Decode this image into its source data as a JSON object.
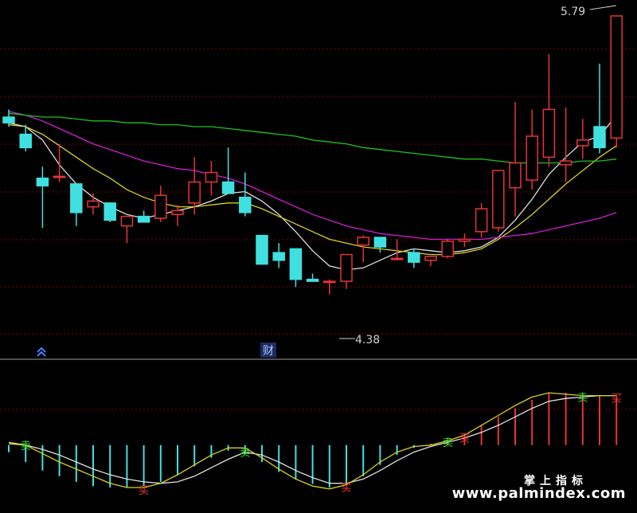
{
  "chart_data": [
    {
      "type": "candlestick",
      "panel": "price",
      "ylim": [
        4.1,
        5.84
      ],
      "high_label": "5.79",
      "low_label": "4.38",
      "event_marker": "财",
      "candles": [
        {
          "o": 5.26,
          "h": 5.3,
          "l": 5.21,
          "c": 5.23
        },
        {
          "o": 5.17,
          "h": 5.22,
          "l": 5.08,
          "c": 5.1
        },
        {
          "o": 4.94,
          "h": 5.0,
          "l": 4.68,
          "c": 4.9
        },
        {
          "o": 4.95,
          "h": 5.12,
          "l": 4.92,
          "c": 4.95
        },
        {
          "o": 4.91,
          "h": 4.91,
          "l": 4.69,
          "c": 4.76
        },
        {
          "o": 4.79,
          "h": 4.86,
          "l": 4.75,
          "c": 4.82
        },
        {
          "o": 4.81,
          "h": 4.81,
          "l": 4.71,
          "c": 4.72
        },
        {
          "o": 4.69,
          "h": 4.74,
          "l": 4.6,
          "c": 4.74
        },
        {
          "o": 4.74,
          "h": 4.77,
          "l": 4.72,
          "c": 4.71
        },
        {
          "o": 4.73,
          "h": 4.9,
          "l": 4.71,
          "c": 4.85
        },
        {
          "o": 4.75,
          "h": 4.8,
          "l": 4.69,
          "c": 4.77
        },
        {
          "o": 4.81,
          "h": 5.05,
          "l": 4.75,
          "c": 4.92
        },
        {
          "o": 4.92,
          "h": 5.03,
          "l": 4.85,
          "c": 4.97
        },
        {
          "o": 4.92,
          "h": 5.1,
          "l": 4.86,
          "c": 4.86
        },
        {
          "o": 4.84,
          "h": 4.97,
          "l": 4.74,
          "c": 4.76
        },
        {
          "o": 4.64,
          "h": 4.64,
          "l": 4.49,
          "c": 4.49
        },
        {
          "o": 4.55,
          "h": 4.6,
          "l": 4.47,
          "c": 4.51
        },
        {
          "o": 4.57,
          "h": 4.57,
          "l": 4.37,
          "c": 4.41
        },
        {
          "o": 4.41,
          "h": 4.44,
          "l": 4.4,
          "c": 4.4
        },
        {
          "o": 4.4,
          "h": 4.41,
          "l": 4.33,
          "c": 4.4
        },
        {
          "o": 4.4,
          "h": 4.54,
          "l": 4.36,
          "c": 4.54
        },
        {
          "o": 4.59,
          "h": 4.64,
          "l": 4.5,
          "c": 4.63
        },
        {
          "o": 4.63,
          "h": 4.63,
          "l": 4.55,
          "c": 4.58
        },
        {
          "o": 4.52,
          "h": 4.62,
          "l": 4.51,
          "c": 4.52
        },
        {
          "o": 4.55,
          "h": 4.57,
          "l": 4.47,
          "c": 4.5
        },
        {
          "o": 4.51,
          "h": 4.53,
          "l": 4.48,
          "c": 4.53
        },
        {
          "o": 4.53,
          "h": 4.62,
          "l": 4.52,
          "c": 4.61
        },
        {
          "o": 4.61,
          "h": 4.65,
          "l": 4.58,
          "c": 4.62
        },
        {
          "o": 4.66,
          "h": 4.81,
          "l": 4.63,
          "c": 4.78
        },
        {
          "o": 4.68,
          "h": 4.98,
          "l": 4.66,
          "c": 4.98
        },
        {
          "o": 4.89,
          "h": 5.34,
          "l": 4.74,
          "c": 5.02
        },
        {
          "o": 4.93,
          "h": 5.3,
          "l": 4.88,
          "c": 5.16
        },
        {
          "o": 5.05,
          "h": 5.59,
          "l": 5.0,
          "c": 5.3
        },
        {
          "o": 5.01,
          "h": 5.31,
          "l": 4.92,
          "c": 5.03
        },
        {
          "o": 5.11,
          "h": 5.25,
          "l": 5.04,
          "c": 5.14
        },
        {
          "o": 5.21,
          "h": 5.54,
          "l": 5.07,
          "c": 5.1
        },
        {
          "o": 5.15,
          "h": 5.79,
          "l": 5.1,
          "c": 5.79
        }
      ],
      "ma_lines": [
        {
          "color": "#e0e0e0",
          "values": [
            5.23,
            5.21,
            5.14,
            5.01,
            4.91,
            4.84,
            4.79,
            4.75,
            4.73,
            4.75,
            4.77,
            4.79,
            4.82,
            4.86,
            4.87,
            4.82,
            4.75,
            4.66,
            4.56,
            4.48,
            4.46,
            4.47,
            4.51,
            4.55,
            4.57,
            4.56,
            4.55,
            4.56,
            4.58,
            4.63,
            4.72,
            4.83,
            4.96,
            5.05,
            5.13,
            5.16,
            5.27
          ]
        },
        {
          "color": "#d8d020",
          "values": [
            5.22,
            5.21,
            5.17,
            5.11,
            5.05,
            4.99,
            4.94,
            4.88,
            4.84,
            4.81,
            4.79,
            4.79,
            4.8,
            4.81,
            4.81,
            4.78,
            4.74,
            4.7,
            4.66,
            4.62,
            4.6,
            4.58,
            4.57,
            4.56,
            4.55,
            4.54,
            4.54,
            4.55,
            4.57,
            4.62,
            4.68,
            4.75,
            4.83,
            4.91,
            4.98,
            5.05,
            5.11
          ]
        },
        {
          "color": "#d020d0",
          "values": [
            5.29,
            5.27,
            5.24,
            5.2,
            5.16,
            5.12,
            5.09,
            5.06,
            5.03,
            5.01,
            4.99,
            4.98,
            4.96,
            4.94,
            4.91,
            4.87,
            4.83,
            4.79,
            4.75,
            4.72,
            4.69,
            4.67,
            4.65,
            4.64,
            4.63,
            4.62,
            4.62,
            4.62,
            4.62,
            4.63,
            4.64,
            4.65,
            4.67,
            4.69,
            4.71,
            4.73,
            4.76
          ]
        },
        {
          "color": "#20c020",
          "values": [
            5.28,
            5.27,
            5.26,
            5.26,
            5.25,
            5.24,
            5.24,
            5.23,
            5.23,
            5.22,
            5.22,
            5.21,
            5.21,
            5.2,
            5.19,
            5.18,
            5.17,
            5.16,
            5.14,
            5.13,
            5.12,
            5.1,
            5.09,
            5.08,
            5.07,
            5.06,
            5.05,
            5.04,
            5.04,
            5.03,
            5.02,
            5.02,
            5.02,
            5.02,
            5.03,
            5.03,
            5.04
          ]
        }
      ]
    },
    {
      "type": "bar",
      "panel": "indicator",
      "ylim": [
        -60,
        100
      ],
      "bars": [
        -10,
        -24,
        -36,
        -44,
        -52,
        -58,
        -60,
        -60,
        -58,
        -52,
        -42,
        -30,
        -18,
        -8,
        -12,
        -24,
        -38,
        -48,
        -55,
        -60,
        -56,
        -44,
        -28,
        -14,
        -4,
        2,
        8,
        16,
        28,
        40,
        52,
        64,
        74,
        74,
        72,
        70,
        68
      ],
      "slow_line": [
        2,
        0,
        -6,
        -14,
        -24,
        -34,
        -42,
        -48,
        -52,
        -54,
        -52,
        -44,
        -32,
        -20,
        -10,
        -14,
        -24,
        -36,
        -46,
        -54,
        -54,
        -48,
        -36,
        -22,
        -10,
        -2,
        4,
        10,
        18,
        28,
        40,
        52,
        62,
        66,
        68,
        70,
        70
      ],
      "fast_line": [
        4,
        0,
        -12,
        -24,
        -34,
        -44,
        -54,
        -60,
        -60,
        -54,
        -42,
        -28,
        -14,
        -4,
        -4,
        -18,
        -34,
        -48,
        -58,
        -62,
        -56,
        -42,
        -24,
        -10,
        -2,
        0,
        6,
        14,
        28,
        42,
        56,
        68,
        74,
        72,
        70,
        70,
        70
      ],
      "buy_marks": [
        {
          "i": 8,
          "label": "买"
        },
        {
          "i": 20,
          "label": "买"
        },
        {
          "i": 27,
          "label": "买"
        },
        {
          "i": 36,
          "label": "买"
        }
      ],
      "sell_marks": [
        {
          "i": 1,
          "label": "卖"
        },
        {
          "i": 14,
          "label": "卖"
        },
        {
          "i": 26,
          "label": "卖"
        },
        {
          "i": 34,
          "label": "卖"
        }
      ]
    }
  ],
  "watermark": {
    "line1": "掌上指标",
    "line2": "www.palmindex.com"
  },
  "colors": {
    "up": "#e83434",
    "down": "#40e0e0",
    "grid": "#8a0000",
    "divider": "#a0a0a0",
    "low_arrow": "#d0d0d0"
  }
}
